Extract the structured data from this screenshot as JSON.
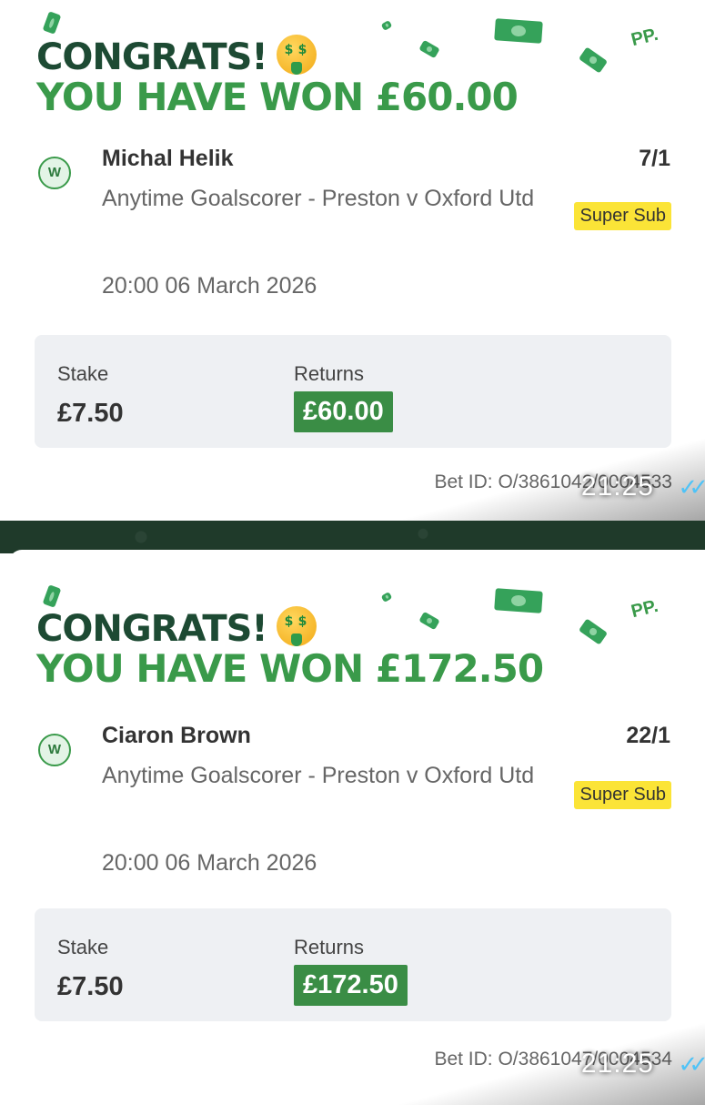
{
  "cards": [
    {
      "congrats": "CONGRATS!",
      "won_text": "YOU HAVE WON £60.00",
      "badge": "W",
      "selection": "Michal Helik",
      "odds": "7/1",
      "market": "Anytime Goalscorer - Preston v Oxford Utd",
      "tag": "Super Sub",
      "datetime": "20:00 06 March 2026",
      "stake_label": "Stake",
      "stake_value": "£7.50",
      "returns_label": "Returns",
      "returns_value": "£60.00",
      "bet_id": "Bet ID: O/3861042/0004533",
      "message_time": "21:25",
      "pp": "PP."
    },
    {
      "congrats": "CONGRATS!",
      "won_text": "YOU HAVE WON £172.50",
      "badge": "W",
      "selection": "Ciaron Brown",
      "odds": "22/1",
      "market": "Anytime Goalscorer - Preston v Oxford Utd",
      "tag": "Super Sub",
      "datetime": "20:00 06 March 2026",
      "stake_label": "Stake",
      "stake_value": "£7.50",
      "returns_label": "Returns",
      "returns_value": "£172.50",
      "bet_id": "Bet ID: O/3861047/0004534",
      "message_time": "21:25",
      "pp": "PP."
    }
  ],
  "colors": {
    "brand_dark_green": "#1d4a33",
    "brand_green": "#3a9a4a",
    "returns_bg": "#3a8d45",
    "tag_yellow": "#fbe437",
    "tick_blue": "#4fc3f7"
  },
  "icons": [
    "money-mouth-emoji-icon",
    "banknote-icon",
    "double-tick-icon"
  ]
}
